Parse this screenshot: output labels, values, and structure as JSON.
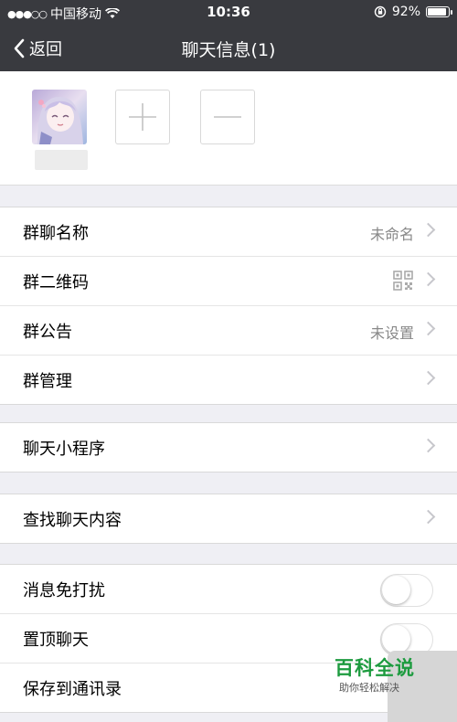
{
  "status_bar": {
    "signal_dots": "●●●○○",
    "carrier": "中国移动",
    "time": "10:36",
    "battery_text": "92%",
    "battery_level": 0.92
  },
  "nav": {
    "back_label": "返回",
    "title": "聊天信息(1)"
  },
  "group1": {
    "name_label": "群聊名称",
    "name_value": "未命名",
    "qrcode_label": "群二维码",
    "notice_label": "群公告",
    "notice_value": "未设置",
    "manage_label": "群管理"
  },
  "group2": {
    "miniprogram_label": "聊天小程序"
  },
  "group3": {
    "search_label": "查找聊天内容"
  },
  "group4": {
    "mute_label": "消息免打扰",
    "mute_on": false,
    "pin_label": "置顶聊天",
    "pin_on": false,
    "save_label": "保存到通讯录"
  },
  "watermark": {
    "title": "百科全说",
    "subtitle": "助你轻松解决"
  }
}
